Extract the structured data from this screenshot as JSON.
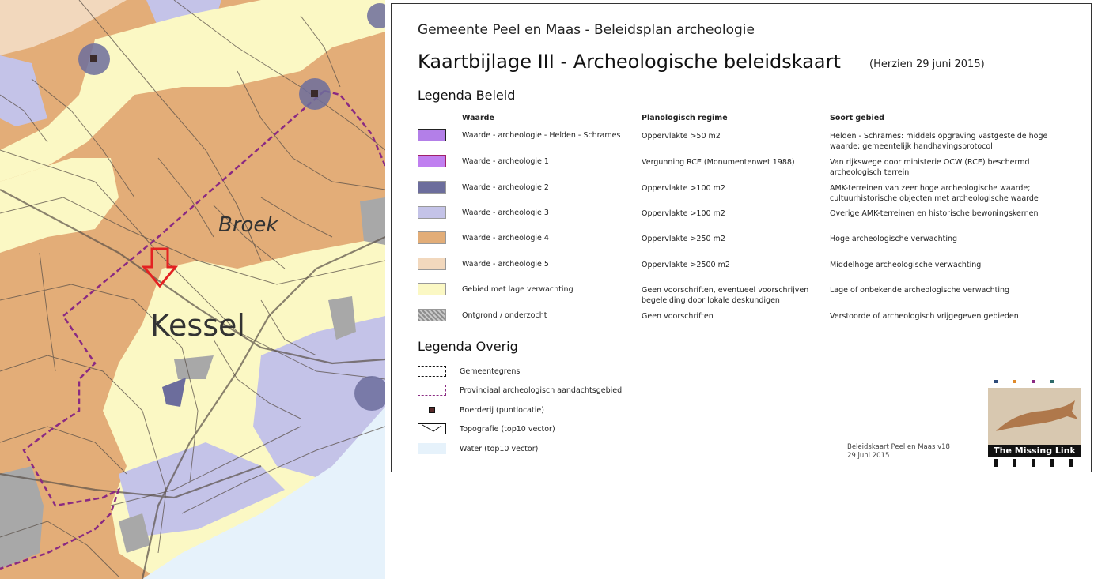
{
  "map": {
    "place_labels": {
      "broek": "Broek",
      "kessel": "Kessel"
    },
    "marker": "red-down-arrow"
  },
  "legend": {
    "subtitle": "Gemeente Peel en Maas - Beleidsplan archeologie",
    "title": "Kaartbijlage III - Archeologische beleidskaart",
    "date": "(Herzien 29 juni 2015)",
    "section_beleid": "Legenda Beleid",
    "columns": {
      "waarde": "Waarde",
      "regime": "Planologisch regime",
      "soort": "Soort gebied"
    },
    "rows": [
      {
        "color": "#b37fe8",
        "waarde": "Waarde - archeologie - Helden - Schrames",
        "regime": "Oppervlakte >50 m2",
        "soort": "Helden - Schrames: middels opgraving vastgestelde hoge waarde; gemeentelijk handhavingsprotocol"
      },
      {
        "color": "#c07ff0",
        "waarde": "Waarde - archeologie 1",
        "regime": "Vergunning RCE (Monumentenwet 1988)",
        "soort": "Van rijkswege door ministerie OCW (RCE) beschermd archeologisch terrein"
      },
      {
        "color": "#6c6d9c",
        "waarde": "Waarde - archeologie 2",
        "regime": "Oppervlakte >100 m2",
        "soort": "AMK-terreinen van zeer hoge archeologische waarde; cultuurhistorische objecten met archeologische waarde"
      },
      {
        "color": "#c4c3e8",
        "waarde": "Waarde - archeologie 3",
        "regime": "Oppervlakte >100 m2",
        "soort": "Overige AMK-terreinen en historische bewoningskernen"
      },
      {
        "color": "#e2ad78",
        "waarde": "Waarde - archeologie 4",
        "regime": "Oppervlakte >250 m2",
        "soort": "Hoge archeologische verwachting"
      },
      {
        "color": "#f2d8bd",
        "waarde": "Waarde - archeologie 5",
        "regime": "Oppervlakte >2500 m2",
        "soort": "Middelhoge archeologische verwachting"
      },
      {
        "color": "#fbf8c4",
        "waarde": "Gebied met lage verwachting",
        "regime": "Geen voorschriften, eventueel voorschrijven begeleiding door lokale deskundigen",
        "soort": "Lage of onbekende archeologische verwachting"
      },
      {
        "color": "#aaaaaa",
        "waarde": "Ontgrond / onderzocht",
        "regime": "Geen voorschriften",
        "soort": "Verstoorde of archeologisch vrijgegeven gebieden"
      }
    ],
    "section_overig": "Legenda Overig",
    "overig": [
      {
        "icon": "municipal-boundary-icon",
        "label": "Gemeentegrens"
      },
      {
        "icon": "provincial-area-icon",
        "label": "Provinciaal archeologisch aandachtsgebied"
      },
      {
        "icon": "farm-point-icon",
        "label": "Boerderij (puntlocatie)"
      },
      {
        "icon": "topography-icon",
        "label": "Topografie (top10 vector)"
      },
      {
        "icon": "water-icon",
        "label": "Water (top10 vector)"
      }
    ],
    "version_line1": "Beleidskaart Peel en Maas v18",
    "version_line2": "29 juni 2015",
    "logo_text": "The Missing Link",
    "colors": {
      "provincial_line": "#8a2a82",
      "water": "#e6f2fb"
    }
  }
}
